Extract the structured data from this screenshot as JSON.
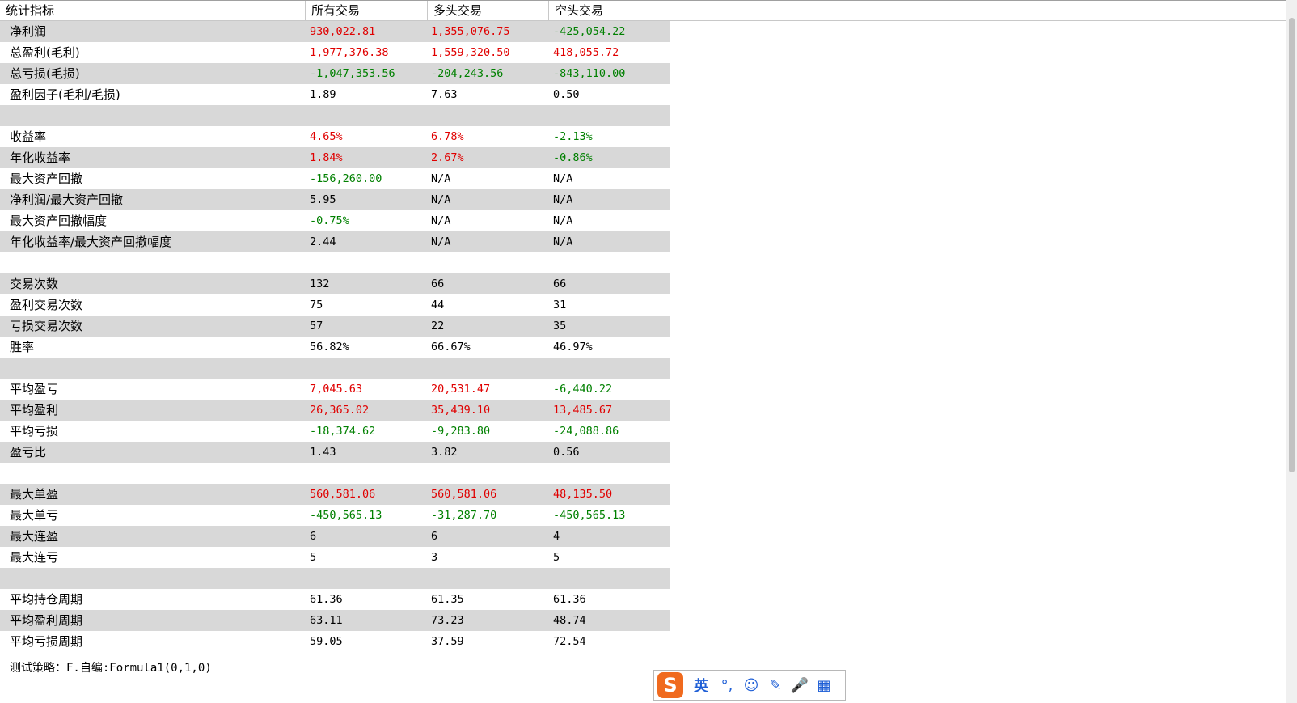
{
  "header": {
    "col0": "统计指标",
    "col1": "所有交易",
    "col2": "多头交易",
    "col3": "空头交易"
  },
  "rows": [
    {
      "label": "净利润",
      "v1": "930,022.81",
      "v2": "1,355,076.75",
      "v3": "-425,054.22",
      "c1": "pos",
      "c2": "pos",
      "c3": "neg"
    },
    {
      "label": "总盈利(毛利)",
      "v1": "1,977,376.38",
      "v2": "1,559,320.50",
      "v3": "418,055.72",
      "c1": "pos",
      "c2": "pos",
      "c3": "pos"
    },
    {
      "label": "总亏损(毛损)",
      "v1": "-1,047,353.56",
      "v2": "-204,243.56",
      "v3": "-843,110.00",
      "c1": "neg",
      "c2": "neg",
      "c3": "neg"
    },
    {
      "label": "盈利因子(毛利/毛损)",
      "v1": "1.89",
      "v2": "7.63",
      "v3": "0.50",
      "c1": "neu",
      "c2": "neu",
      "c3": "neu"
    },
    {
      "label": "",
      "v1": "",
      "v2": "",
      "v3": "",
      "c1": "neu",
      "c2": "neu",
      "c3": "neu"
    },
    {
      "label": "收益率",
      "v1": "4.65%",
      "v2": "6.78%",
      "v3": "-2.13%",
      "c1": "pos",
      "c2": "pos",
      "c3": "neg"
    },
    {
      "label": "年化收益率",
      "v1": "1.84%",
      "v2": "2.67%",
      "v3": "-0.86%",
      "c1": "pos",
      "c2": "pos",
      "c3": "neg"
    },
    {
      "label": "最大资产回撤",
      "v1": "-156,260.00",
      "v2": "N/A",
      "v3": "N/A",
      "c1": "neg",
      "c2": "neu",
      "c3": "neu"
    },
    {
      "label": "净利润/最大资产回撤",
      "v1": "5.95",
      "v2": "N/A",
      "v3": "N/A",
      "c1": "neu",
      "c2": "neu",
      "c3": "neu"
    },
    {
      "label": "最大资产回撤幅度",
      "v1": "-0.75%",
      "v2": "N/A",
      "v3": "N/A",
      "c1": "neg",
      "c2": "neu",
      "c3": "neu"
    },
    {
      "label": "年化收益率/最大资产回撤幅度",
      "v1": "2.44",
      "v2": "N/A",
      "v3": "N/A",
      "c1": "neu",
      "c2": "neu",
      "c3": "neu"
    },
    {
      "label": "",
      "v1": "",
      "v2": "",
      "v3": "",
      "c1": "neu",
      "c2": "neu",
      "c3": "neu"
    },
    {
      "label": "交易次数",
      "v1": "132",
      "v2": "66",
      "v3": "66",
      "c1": "neu",
      "c2": "neu",
      "c3": "neu"
    },
    {
      "label": "盈利交易次数",
      "v1": "75",
      "v2": "44",
      "v3": "31",
      "c1": "neu",
      "c2": "neu",
      "c3": "neu"
    },
    {
      "label": "亏损交易次数",
      "v1": "57",
      "v2": "22",
      "v3": "35",
      "c1": "neu",
      "c2": "neu",
      "c3": "neu"
    },
    {
      "label": "胜率",
      "v1": "56.82%",
      "v2": "66.67%",
      "v3": "46.97%",
      "c1": "neu",
      "c2": "neu",
      "c3": "neu"
    },
    {
      "label": "",
      "v1": "",
      "v2": "",
      "v3": "",
      "c1": "neu",
      "c2": "neu",
      "c3": "neu"
    },
    {
      "label": "平均盈亏",
      "v1": "7,045.63",
      "v2": "20,531.47",
      "v3": "-6,440.22",
      "c1": "pos",
      "c2": "pos",
      "c3": "neg"
    },
    {
      "label": "平均盈利",
      "v1": "26,365.02",
      "v2": "35,439.10",
      "v3": "13,485.67",
      "c1": "pos",
      "c2": "pos",
      "c3": "pos"
    },
    {
      "label": "平均亏损",
      "v1": "-18,374.62",
      "v2": "-9,283.80",
      "v3": "-24,088.86",
      "c1": "neg",
      "c2": "neg",
      "c3": "neg"
    },
    {
      "label": "盈亏比",
      "v1": "1.43",
      "v2": "3.82",
      "v3": "0.56",
      "c1": "neu",
      "c2": "neu",
      "c3": "neu"
    },
    {
      "label": "",
      "v1": "",
      "v2": "",
      "v3": "",
      "c1": "neu",
      "c2": "neu",
      "c3": "neu"
    },
    {
      "label": "最大单盈",
      "v1": "560,581.06",
      "v2": "560,581.06",
      "v3": "48,135.50",
      "c1": "pos",
      "c2": "pos",
      "c3": "pos"
    },
    {
      "label": "最大单亏",
      "v1": "-450,565.13",
      "v2": "-31,287.70",
      "v3": "-450,565.13",
      "c1": "neg",
      "c2": "neg",
      "c3": "neg"
    },
    {
      "label": "最大连盈",
      "v1": "6",
      "v2": "6",
      "v3": "4",
      "c1": "neu",
      "c2": "neu",
      "c3": "neu"
    },
    {
      "label": "最大连亏",
      "v1": "5",
      "v2": "3",
      "v3": "5",
      "c1": "neu",
      "c2": "neu",
      "c3": "neu"
    },
    {
      "label": "",
      "v1": "",
      "v2": "",
      "v3": "",
      "c1": "neu",
      "c2": "neu",
      "c3": "neu"
    },
    {
      "label": "平均持仓周期",
      "v1": "61.36",
      "v2": "61.35",
      "v3": "61.36",
      "c1": "neu",
      "c2": "neu",
      "c3": "neu"
    },
    {
      "label": "平均盈利周期",
      "v1": "63.11",
      "v2": "73.23",
      "v3": "48.74",
      "c1": "neu",
      "c2": "neu",
      "c3": "neu"
    },
    {
      "label": "平均亏损周期",
      "v1": "59.05",
      "v2": "37.59",
      "v3": "72.54",
      "c1": "neu",
      "c2": "neu",
      "c3": "neu"
    }
  ],
  "footer": {
    "strategy_label": "测试策略：",
    "strategy_value": "F.自编:Formula1(0,1,0)"
  },
  "ime": {
    "logo": "S",
    "lang": "英",
    "punct": "°,",
    "emoji": "☺",
    "pen": "✎",
    "mic": "🎤",
    "grid": "▦"
  },
  "colors": {
    "positive": "#e00000",
    "negative": "#008000",
    "shade": "#d8d8d8"
  }
}
